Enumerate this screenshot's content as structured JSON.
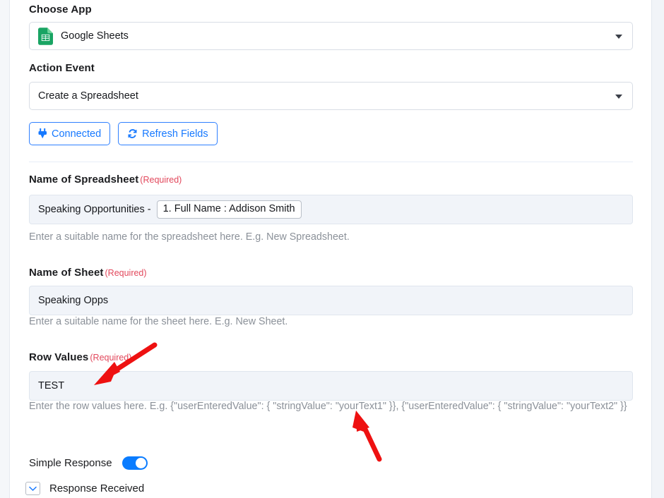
{
  "form": {
    "choose_app": {
      "label": "Choose App",
      "value": "Google Sheets",
      "icon": "google-sheets-icon",
      "caret": "chevron-down-icon"
    },
    "action_event": {
      "label": "Action Event",
      "value": "Create a Spreadsheet",
      "caret": "chevron-down-icon"
    },
    "buttons": [
      {
        "label": "Connected",
        "icon": "plug-icon"
      },
      {
        "label": "Refresh Fields",
        "icon": "refresh-icon"
      }
    ],
    "fields": [
      {
        "label": "Name of Spreadsheet",
        "required": "(Required)",
        "value": "Speaking Opportunities -",
        "token": "1. Full Name : Addison Smith",
        "helper": "Enter a suitable name for the spreadsheet here. E.g. New Spreadsheet."
      },
      {
        "label": "Name of Sheet",
        "required": "(Required)",
        "value": "Speaking Opps",
        "token": "",
        "helper": "Enter a suitable name for the sheet here. E.g. New Sheet."
      },
      {
        "label": "Row Values",
        "required": "(Required)",
        "value": "TEST",
        "token": "",
        "helper": "Enter the row values here. E.g. {\"userEnteredValue\": { \"stringValue\": \"yourText1\" }}, {\"userEnteredValue\": { \"stringValue\": \"yourText2\" }}"
      }
    ],
    "simple_response": {
      "label": "Simple Response",
      "state": "on"
    },
    "response_received": {
      "label": "Response Received",
      "icon": "chevron-down-icon"
    }
  },
  "colors": {
    "accent_blue": "#1779ff",
    "required_red": "#e2485c",
    "sheets_green": "#19a463",
    "toggle_on": "#0a7cff",
    "annotation_red": "#ee1111",
    "input_bg": "#f1f4f9",
    "helper_gray": "#8b9199"
  },
  "annotations": [
    {
      "name": "arrow-to-row-values-input",
      "direction": "down-left"
    },
    {
      "name": "arrow-to-helper-text",
      "direction": "up-left"
    }
  ]
}
